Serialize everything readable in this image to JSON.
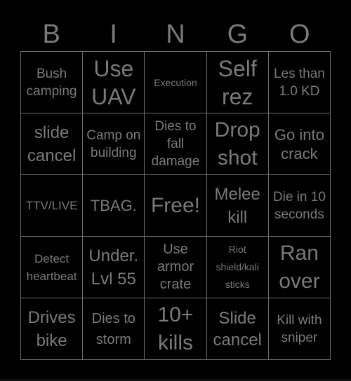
{
  "card": {
    "header_letters": [
      "B",
      "I",
      "N",
      "G",
      "O"
    ],
    "cells": [
      [
        "Bush camping",
        "Use UAV",
        "Execution",
        "Self rez",
        "Les than 1.0 KD"
      ],
      [
        "slide cancel",
        "Camp on building",
        "Dies to fall damage",
        "Drop shot",
        "Go into crack"
      ],
      [
        "TTV/LIVE",
        "TBAG.",
        "Free!",
        "Melee kill",
        "Die in 10 seconds"
      ],
      [
        "Detect heartbeat",
        "Under. Lvl 55",
        "Use armor crate",
        "Riot shield/kali sticks",
        "Ran over"
      ],
      [
        "Drives bike",
        "Dies to storm",
        "10+ kills",
        "Slide cancel",
        "Kill with sniper"
      ]
    ],
    "free_space": "Free!"
  },
  "colors": {
    "background": "#000000",
    "text": "#7a7a7a",
    "grid_line": "#6e6e6e"
  }
}
